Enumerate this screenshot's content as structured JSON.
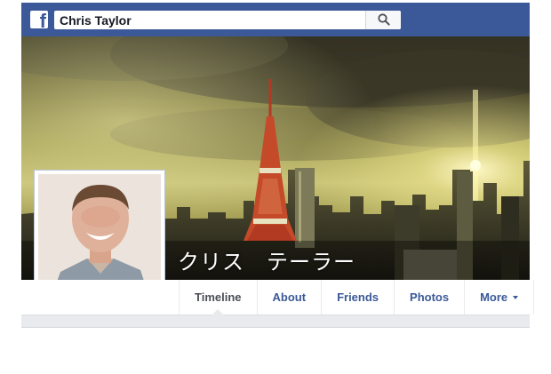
{
  "header": {
    "logo_icon": "facebook-f-icon",
    "search": {
      "value": "Chris Taylor",
      "button_icon": "search-icon"
    },
    "brand_color": "#3b5998"
  },
  "profile": {
    "cover_name": "クリス　テーラー",
    "avatar_description_icon": "profile-photo"
  },
  "tabs": [
    {
      "label": "Timeline",
      "active": true
    },
    {
      "label": "About",
      "active": false
    },
    {
      "label": "Friends",
      "active": false
    },
    {
      "label": "Photos",
      "active": false
    },
    {
      "label": "More",
      "active": false,
      "dropdown": true
    }
  ]
}
